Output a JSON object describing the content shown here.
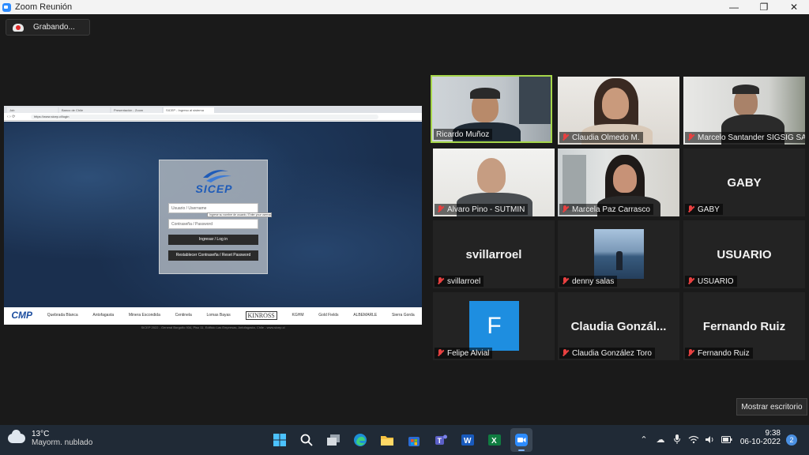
{
  "window": {
    "title": "Zoom Reunión",
    "controls": {
      "minimize": "—",
      "maximize": "❐",
      "close": "✕"
    }
  },
  "recording": {
    "label": "Grabando..."
  },
  "shared_screen": {
    "tabs": [
      "Job",
      "Banco de Chile",
      "Presentación - Zoom",
      "SICEP - Ingreso al sistema"
    ],
    "url": "https://www.sicep.cl/login",
    "logo_text": "SICEP",
    "username_placeholder": "Usuario / Username",
    "password_placeholder": "Contraseña / Password",
    "tooltip": "Ingrese su nombre de usuario / Enter your username",
    "login_button": "Ingresar / Log in",
    "reset_button": "Restablecer Contraseña / Reset Password",
    "sponsors": [
      "CMP",
      "Quebrada Blanca",
      "Antofagasta",
      "Minera Escondida",
      "Centinela",
      "Lomas Bayas",
      "KINROSS",
      "KGHM",
      "Gold Fields",
      "ALBEMARLE",
      "Sierra Gorda"
    ],
    "footer": "SICEP 2022 - General Borgoño 934, Piso 11, Edificio Las Empresas, Antofagasta, Chile - www.sicep.cl"
  },
  "participants": [
    {
      "name": "Ricardo Muñoz",
      "muted": false,
      "active_speaker": true,
      "video": true
    },
    {
      "name": "Claudia Olmedo M.",
      "muted": true,
      "video": true
    },
    {
      "name": "Marcelo Santander SIGSIG SA",
      "muted": true,
      "video": true
    },
    {
      "name": "Alvaro Pino - SUTMIN",
      "muted": true,
      "video": true
    },
    {
      "name": "Marcela Paz Carrasco",
      "muted": true,
      "video": true
    },
    {
      "name": "GABY",
      "display": "GABY",
      "muted": true,
      "video": false
    },
    {
      "name": "svillarroel",
      "display": "svillarroel",
      "muted": true,
      "video": false
    },
    {
      "name": "denny salas",
      "muted": true,
      "video": false
    },
    {
      "name": "USUARIO",
      "display": "USUARIO",
      "muted": true,
      "video": false
    },
    {
      "name": "Felipe Alvial",
      "avatar_letter": "F",
      "muted": true,
      "video": false
    },
    {
      "name": "Claudia González Toro",
      "display": "Claudia Gonzál...",
      "muted": true,
      "video": false
    },
    {
      "name": "Fernando Ruiz",
      "display": "Fernando Ruiz",
      "muted": true,
      "video": false
    }
  ],
  "show_desktop": "Mostrar escritorio",
  "taskbar": {
    "weather": {
      "temp": "13°C",
      "condition": "Mayorm. nublado"
    },
    "apps": [
      "windows-start-icon",
      "search-icon",
      "task-view-icon",
      "edge-icon",
      "file-explorer-icon",
      "store-icon",
      "teams-icon",
      "word-icon",
      "excel-icon",
      "zoom-icon"
    ],
    "clock": {
      "time": "9:38",
      "date": "06-10-2022"
    },
    "notifications": "2"
  },
  "colors": {
    "active_speaker": "#a6d64a",
    "muted_mic": "#e84040",
    "avatar_blue": "#1e8ee0",
    "zoom_blue": "#2d8cff"
  }
}
